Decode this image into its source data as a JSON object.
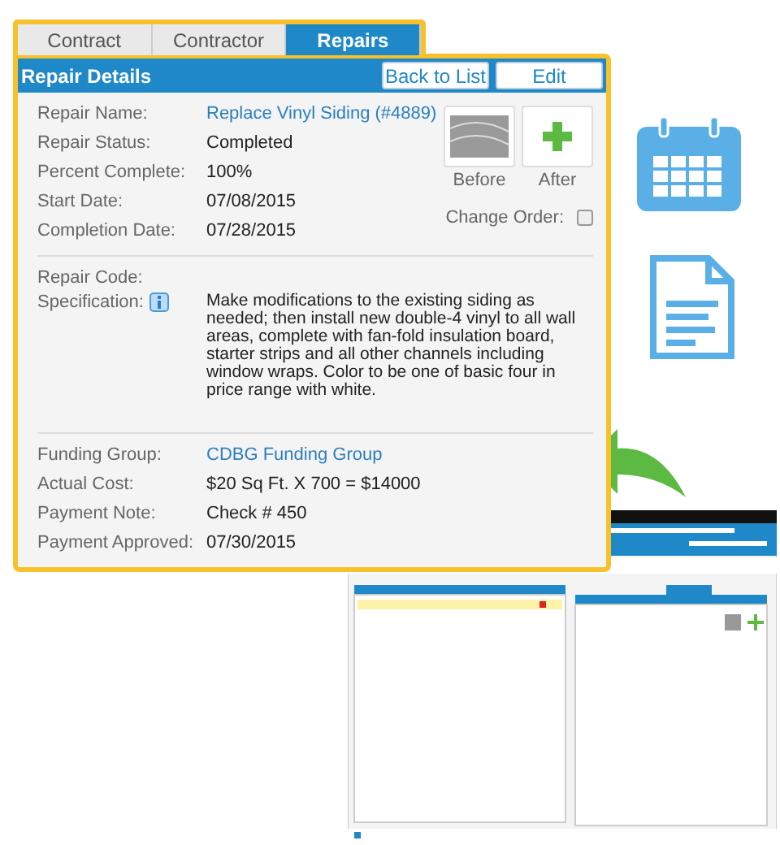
{
  "tabs": [
    {
      "label": "Contract",
      "selected": false
    },
    {
      "label": "Contractor",
      "selected": false
    },
    {
      "label": "Repairs",
      "selected": true
    }
  ],
  "header": {
    "title": "Repair Details",
    "buttons": [
      "Back to List",
      "Edit"
    ]
  },
  "fields": [
    {
      "label": "Repair Name:",
      "value": "Replace Vinyl Siding (#4889)",
      "kind": "link"
    },
    {
      "label": "Repair Status:",
      "value": "Completed",
      "kind": "text"
    },
    {
      "label": "Percent Complete:",
      "value": "100%",
      "kind": "text"
    },
    {
      "label": "Start Date:",
      "value": "07/08/2015",
      "kind": "text"
    },
    {
      "label": "Completion Date:",
      "value": "07/28/2015",
      "kind": "text"
    }
  ],
  "photos": [
    {
      "caption": "Before",
      "kind": "photo"
    },
    {
      "caption": "After",
      "kind": "add"
    }
  ],
  "change_order": {
    "label": "Change Order:",
    "checked": false
  },
  "repair_code": {
    "label": "Repair Code:"
  },
  "specification": {
    "label": "Specification:",
    "value": "Make modifications to the existing siding as needed; then install new double-4 vinyl to all wall areas, complete with fan-fold insulation board, starter strips and all other channels including window wraps.  Color to be one of basic four in price range with white."
  },
  "payment_fields": [
    {
      "label": "Funding Group:",
      "value": "CDBG Funding Group",
      "kind": "link"
    },
    {
      "label": "Actual Cost:",
      "value": "$20 Sq Ft. X 700 = $14000",
      "kind": "text"
    },
    {
      "label": "Payment Note:",
      "value": "Check # 450",
      "kind": "text"
    },
    {
      "label": "Payment Approved:",
      "value": "07/30/2015",
      "kind": "text"
    }
  ]
}
